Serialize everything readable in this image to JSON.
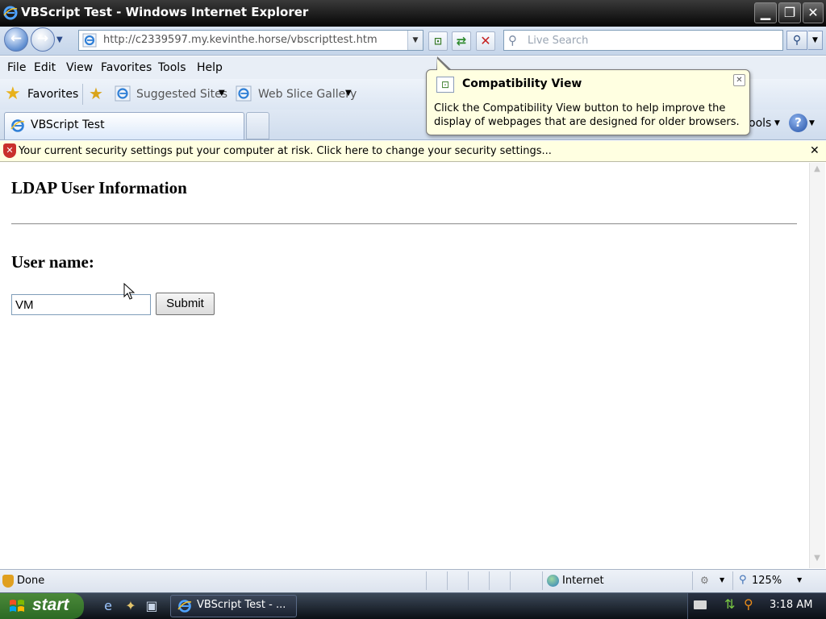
{
  "window": {
    "title": "VBScript Test - Windows Internet Explorer",
    "minimize_glyph": "▁",
    "maximize_glyph": "❐",
    "close_glyph": "✕"
  },
  "nav": {
    "back_glyph": "←",
    "forward_glyph": "→",
    "dropdown_glyph": "▼"
  },
  "address": {
    "url": "http://c2339597.my.kevinthe.horse/vbscripttest.htm",
    "dropdown_glyph": "▼"
  },
  "toolbar": {
    "compat_glyph": "⊡",
    "refresh_glyph": "⇄",
    "stop_glyph": "✕"
  },
  "search": {
    "placeholder": "Live Search",
    "icon_glyph": "⚲",
    "go_glyph": "⚲",
    "dropdown_glyph": "▼"
  },
  "menu": {
    "file": "File",
    "edit": "Edit",
    "view": "View",
    "favorites": "Favorites",
    "tools": "Tools",
    "help": "Help"
  },
  "favorites_bar": {
    "favorites_label": "Favorites",
    "star_glyph": "★",
    "add_glyph": "★",
    "suggested_sites": "Suggested Sites",
    "web_slice_gallery": "Web Slice Gallery",
    "arrow_glyph": "▼"
  },
  "tab": {
    "active_label": "VBScript Test"
  },
  "command_bar": {
    "tools_label": "ools",
    "arrow_glyph": "▼",
    "help_glyph": "?"
  },
  "infobar": {
    "text": "Your current security settings put your computer at risk. Click here to change your security settings...",
    "shield_glyph": "✕",
    "close_glyph": "✕"
  },
  "callout": {
    "title": "Compatibility View",
    "body": "Click the Compatibility View button to help improve the display of webpages that are designed for older browsers.",
    "close_glyph": "✕",
    "icon_glyph": "⊡"
  },
  "page": {
    "heading": "LDAP User Information",
    "username_label": "User name:",
    "username_value": "VM",
    "submit_label": "Submit"
  },
  "scrollbar": {
    "up_glyph": "▲",
    "down_glyph": "▼"
  },
  "status": {
    "text": "Done",
    "zone": "Internet",
    "protected_glyph": "⚙",
    "arrow_glyph": "▼",
    "zoom_glyph": "⚲",
    "zoom": "125%"
  },
  "taskbar": {
    "start_label": "start",
    "ql_ie_glyph": "e",
    "ql_2_glyph": "✦",
    "ql_3_glyph": "▣",
    "task_label": "VBScript Test - ...",
    "net_glyph": "⇅",
    "search_glyph": "⚲",
    "clock": "3:18 AM"
  },
  "colors": {
    "titlebar": "#1a1a1a",
    "infobar_bg": "#ffffe1",
    "callout_bg": "#ffffe1",
    "start_green": "#3a7a2e",
    "accent_blue": "#2250a6"
  }
}
